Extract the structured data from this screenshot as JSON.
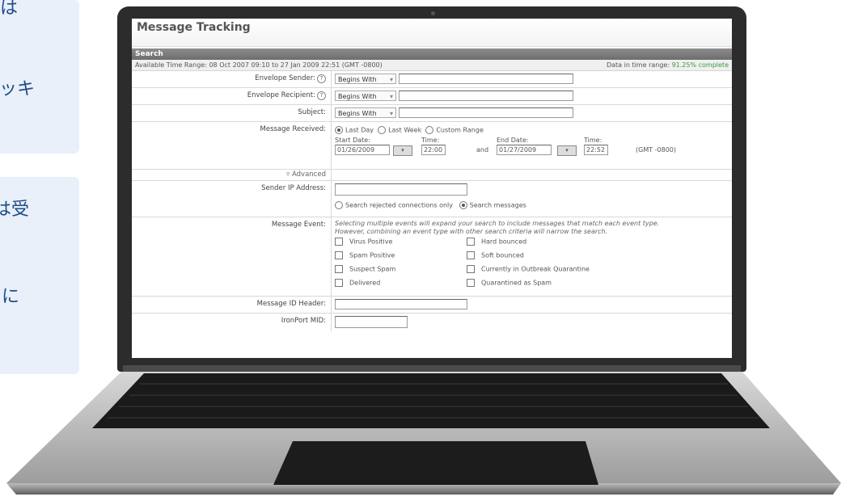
{
  "side_cards": {
    "card1": {
      "line1": "は",
      "line2": "ッキ"
    },
    "card2": {
      "line1": "は受",
      "line2": "に"
    }
  },
  "app": {
    "title": "Message Tracking",
    "section": "Search",
    "time_range": "Available Time Range: 08 Oct 2007 09:10 to 27 Jan 2009 22:51 (GMT -0800)",
    "data_in_range_label": "Data in time range:",
    "data_in_range_value": "91.25% complete",
    "fields": {
      "envelope_sender": {
        "label": "Envelope Sender:",
        "op": "Begins With"
      },
      "envelope_recipient": {
        "label": "Envelope Recipient:",
        "op": "Begins With"
      },
      "subject": {
        "label": "Subject:",
        "op": "Begins With"
      }
    },
    "help_glyph": "?",
    "received": {
      "label": "Message Received:",
      "opt_last_day": "Last Day",
      "opt_last_week": "Last Week",
      "opt_custom": "Custom Range",
      "start_date_label": "Start Date:",
      "start_date": "01/26/2009",
      "start_time_label": "Time:",
      "start_time": "22:00",
      "and": "and",
      "end_date_label": "End Date:",
      "end_date": "01/27/2009",
      "end_time_label": "Time:",
      "end_time": "22:52",
      "tz": "(GMT -0800)"
    },
    "advanced": "▿ Advanced",
    "sender_ip": {
      "label": "Sender IP Address:",
      "opt_rejected": "Search rejected connections only",
      "opt_messages": "Search messages"
    },
    "event": {
      "label": "Message Event:",
      "hint1": "Selecting multiple events will expand your search to include messages that match each event type.",
      "hint2": "However, combining an event type with other search criteria will narrow the search.",
      "left": [
        "Virus Positive",
        "Spam Positive",
        "Suspect Spam",
        "Delivered"
      ],
      "right": [
        "Hard bounced",
        "Soft bounced",
        "Currently in Outbreak Quarantine",
        "Quarantined as Spam"
      ]
    },
    "msgid_label": "Message ID Header:",
    "mid_label": "IronPort MID:"
  },
  "colors": {
    "card_bg": "#e9f0fa",
    "card_text": "#1f4c86",
    "bar": "#7a7a7a"
  }
}
